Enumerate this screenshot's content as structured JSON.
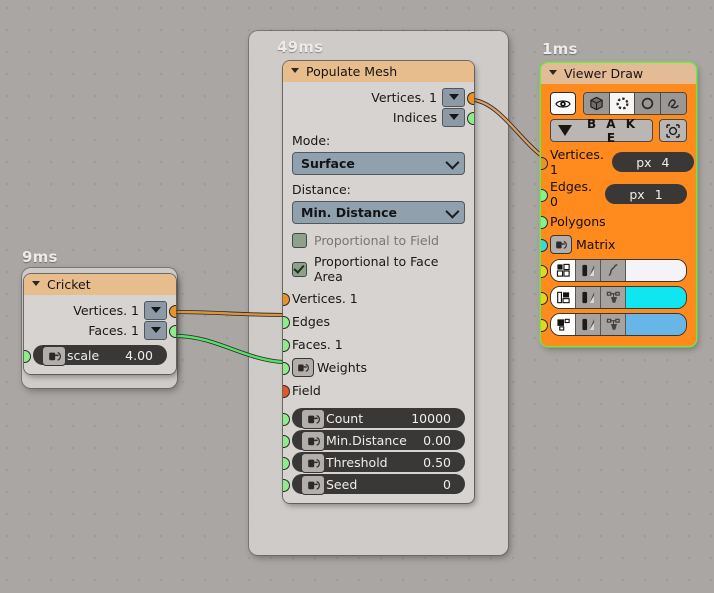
{
  "frames": [
    {
      "time_label": "49ms"
    },
    {
      "time_label": "9ms"
    },
    {
      "time_label": "1ms"
    }
  ],
  "colors": {
    "background": "#a9a6a4",
    "frame": "#cfcbc8",
    "node_body": "#d6d3d0",
    "header": "#e8bd8e",
    "viewer_body": "#ff8b1f",
    "viewer_border": "#6ee93f",
    "socket_vertices": "#e8922a",
    "socket_green": "#8bee8b",
    "socket_field": "#e2562a",
    "socket_matrix": "#3fd6d6",
    "socket_yellow": "#e8d320",
    "wire_orange": "#d9963f",
    "wire_green": "#55e06a",
    "swatch_1": "#f4f3f8",
    "swatch_2": "#10e6f0",
    "swatch_3": "#68b6e8"
  },
  "cricket_node": {
    "title": "Cricket",
    "outputs": [
      {
        "label": "Vertices. 1",
        "socket": "orange"
      },
      {
        "label": "Faces. 1",
        "socket": "green"
      }
    ],
    "params": [
      {
        "label": "scale",
        "value": "4.00",
        "socket": "green"
      }
    ]
  },
  "populate_mesh_node": {
    "title": "Populate Mesh",
    "outputs": [
      {
        "label": "Vertices. 1",
        "socket": "orange"
      },
      {
        "label": "Indices",
        "socket": "green"
      }
    ],
    "mode": {
      "label": "Mode:",
      "value": "Surface"
    },
    "distance": {
      "label": "Distance:",
      "value": "Min. Distance"
    },
    "checkboxes": [
      {
        "label": "Proportional to Field",
        "checked": false
      },
      {
        "label": "Proportional to Face Area",
        "checked": true
      }
    ],
    "inputs": [
      {
        "label": "Vertices. 1",
        "socket": "orange",
        "icon": false
      },
      {
        "label": "Edges",
        "socket": "green",
        "icon": false
      },
      {
        "label": "Faces. 1",
        "socket": "green",
        "icon": false
      },
      {
        "label": "Weights",
        "socket": "green",
        "icon": true
      },
      {
        "label": "Field",
        "socket": "field",
        "icon": false
      }
    ],
    "params": [
      {
        "label": "Count",
        "value": "10000",
        "socket": "green"
      },
      {
        "label": "Min.Distance",
        "value": "0.00",
        "socket": "green"
      },
      {
        "label": "Threshold",
        "value": "0.50",
        "socket": "green"
      },
      {
        "label": "Seed",
        "value": "0",
        "socket": "green"
      }
    ]
  },
  "viewer_draw_node": {
    "title": "Viewer Draw",
    "toolbar": {
      "eye_icon": "eye-icon",
      "display_modes": [
        {
          "name": "cube-icon",
          "selected": false
        },
        {
          "name": "vertices-icon",
          "selected": true
        },
        {
          "name": "circle-icon",
          "selected": false
        },
        {
          "name": "surface-icon",
          "selected": false
        }
      ]
    },
    "bake": {
      "label": "B A K E",
      "extra_icon": "target-icon"
    },
    "sockets": [
      {
        "label": "Vertices. 1",
        "socket": "orange",
        "pill_unit": "px",
        "pill_value": "4"
      },
      {
        "label": "Edges. 0",
        "socket": "green",
        "pill_unit": "px",
        "pill_value": "1"
      },
      {
        "label": "Polygons",
        "socket": "green"
      },
      {
        "label": "Matrix",
        "socket": "matrix",
        "icon": true
      }
    ],
    "color_rows": [
      {
        "socket": "yellow",
        "swatch": "#f4f3f8"
      },
      {
        "socket": "yellow",
        "swatch": "#10e6f0"
      },
      {
        "socket": "yellow",
        "swatch": "#68b6e8"
      }
    ]
  }
}
